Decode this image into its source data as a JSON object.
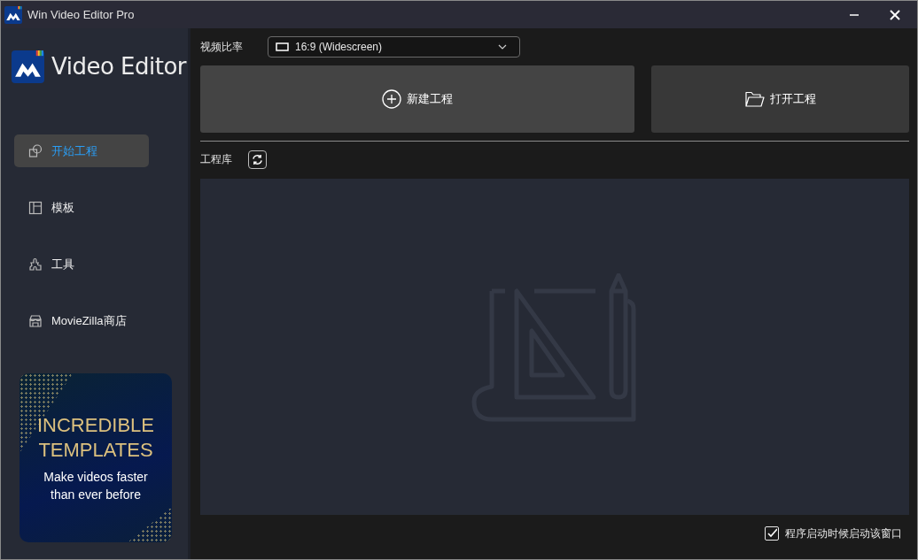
{
  "window": {
    "title": "Win Video Editor Pro"
  },
  "sidebar": {
    "logo_text": "Video Editor",
    "items": [
      {
        "label": "开始工程",
        "selected": true
      },
      {
        "label": "模板",
        "selected": false
      },
      {
        "label": "工具",
        "selected": false
      },
      {
        "label": "MovieZilla商店",
        "selected": false
      }
    ],
    "banner": {
      "headline": [
        "INCREDIBLE",
        "TEMPLATES"
      ],
      "subline": [
        "Make videos faster",
        "than ever before"
      ]
    }
  },
  "aspect_ratio": {
    "label": "视频比率",
    "value": "16:9 (Widescreen)"
  },
  "actions": [
    {
      "kind": "new",
      "label": "新建工程"
    },
    {
      "kind": "open",
      "label": "打开工程"
    }
  ],
  "library": {
    "label": "工程库"
  },
  "startup_option": {
    "label": "程序启动时候启动该窗口",
    "checked": true
  }
}
